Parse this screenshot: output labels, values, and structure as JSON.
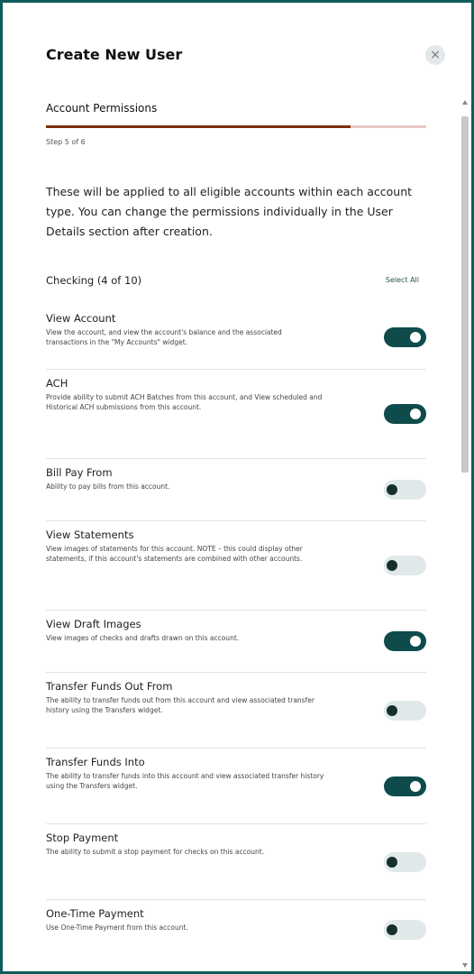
{
  "dialog": {
    "title": "Create New User",
    "close_glyph": "×"
  },
  "step": {
    "section_title": "Account Permissions",
    "label": "Step 5 of 6",
    "progress_fraction": 0.8,
    "progress_color": "#7c2c0b",
    "track_color": "#e6c9c3"
  },
  "intro": "These will be applied to all eligible accounts within each account type. You can change the permissions individually in the User Details section after creation.",
  "group": {
    "title": "Checking (4 of 10)",
    "select_all": "Select All"
  },
  "permissions": [
    {
      "label": "View Account",
      "description": "View the account, and view the account's balance and the associated transactions in the \"My Accounts\" widget.",
      "enabled": true
    },
    {
      "label": "ACH",
      "description": "Provide ability to submit ACH Batches from this account, and View scheduled and Historical ACH submissions from this account.",
      "enabled": true
    },
    {
      "label": "Bill Pay From",
      "description": "Ability to pay bills from this account.",
      "enabled": false
    },
    {
      "label": "View Statements",
      "description": "View images of statements for this account. NOTE – this could display other statements, if this account's statements are combined with other accounts.",
      "enabled": false
    },
    {
      "label": "View Draft Images",
      "description": "View images of checks and drafts drawn on this account.",
      "enabled": true
    },
    {
      "label": "Transfer Funds Out From",
      "description": "The ability to transfer funds out from this account and view associated transfer history using the Transfers widget.",
      "enabled": false
    },
    {
      "label": "Transfer Funds Into",
      "description": "The ability to transfer funds into this account and view associated transfer history using the Transfers widget.",
      "enabled": true
    },
    {
      "label": "Stop Payment",
      "description": "The ability to submit a stop payment for checks on this account.",
      "enabled": false
    },
    {
      "label": "One-Time Payment",
      "description": "Use One-Time Payment from this account.",
      "enabled": false
    }
  ],
  "colors": {
    "frame_border": "#0f5c5b",
    "toggle_on": "#0f4b4b",
    "toggle_off": "#e0e8ea",
    "link": "#1a5a55"
  }
}
